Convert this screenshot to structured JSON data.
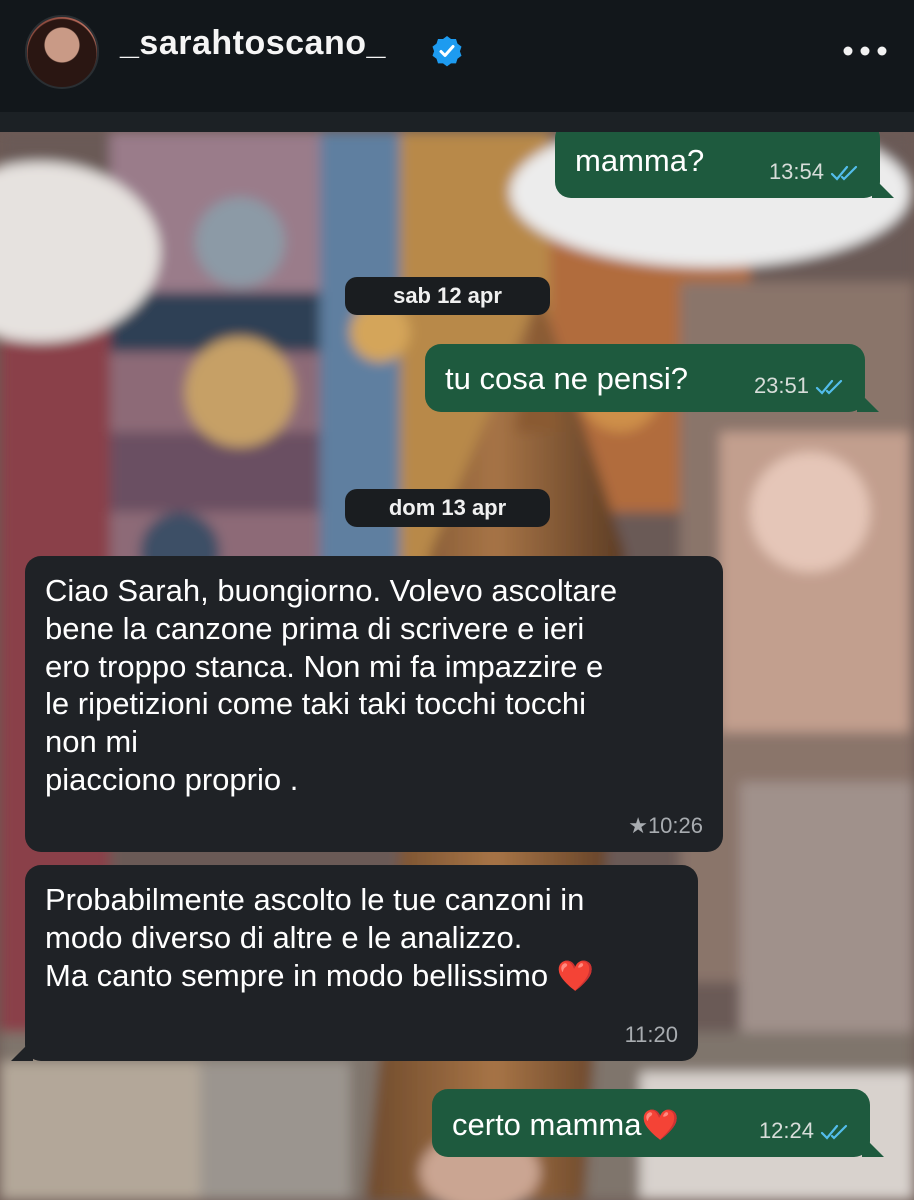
{
  "header": {
    "username": "_sarahtoscano_",
    "verified_icon": "verified-badge-icon",
    "more_icon": "more-options-icon"
  },
  "colors": {
    "outgoing_bubble": "#1e5a3e",
    "incoming_bubble": "#1f2226",
    "read_ticks": "#53bdeb",
    "heart": "#e0161b"
  },
  "chat": {
    "messages": [
      {
        "type": "outgoing",
        "text": "mamma?",
        "time": "13:54",
        "status": "read"
      },
      {
        "type": "date",
        "text": "sab 12 apr"
      },
      {
        "type": "outgoing",
        "text": "tu cosa ne pensi?",
        "time": "23:51",
        "status": "read"
      },
      {
        "type": "date",
        "text": "dom 13 apr"
      },
      {
        "type": "incoming",
        "text": "Ciao Sarah, buongiorno. Volevo ascoltare\nbene la canzone prima di scrivere e ieri\nero troppo stanca. Non mi fa impazzire e\nle ripetizioni come taki taki tocchi tocchi\nnon mi\npiacciono proprio .",
        "time": "★10:26"
      },
      {
        "type": "incoming",
        "text": "Probabilmente ascolto le tue canzoni in\nmodo diverso di altre e le analizzo.\nMa canto sempre in modo bellissimo",
        "emoji": "❤️",
        "time": "11:20"
      },
      {
        "type": "outgoing",
        "text": "certo mamma",
        "emoji": "❤️",
        "time": "12:24",
        "status": "read"
      }
    ]
  }
}
